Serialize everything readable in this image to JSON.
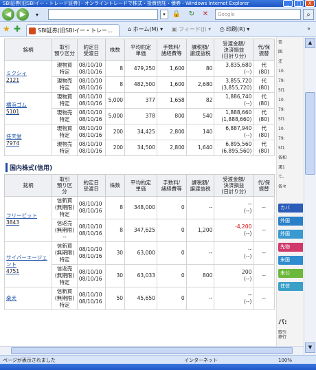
{
  "window": {
    "title": "SBI証券[旧SBIイー・トレード証券] - オンライントレードで株式・投資信託・債券 - Windows Internet Explorer",
    "min": "_",
    "max": "□",
    "close": "X"
  },
  "toolbar": {
    "back_icon": "back-arrow-icon",
    "forward_icon": "forward-arrow-icon",
    "address_value": "",
    "search_placeholder": "Google",
    "search_icon": "magnifier-icon"
  },
  "favbar": {
    "tab_label": "SBI証券(旧SBIイー・トレー...",
    "home_label": "ホーム(M)",
    "feed_label": "フィード(J)",
    "print_label": "印刷(R)",
    "more": "»"
  },
  "genbutsu": {
    "headers": [
      "銘柄",
      "取引\n預り区分",
      "約定日\n受渡日",
      "株数",
      "平均約定\n単価",
      "手数料/\n諸経費等",
      "課税額/\n譲渡益税",
      "受渡金額/\n決済損益\n(日計り分)",
      "代/保\n振替"
    ],
    "stocks": [
      {
        "name": "ミクシィ",
        "code": "2121",
        "rows": [
          {
            "type": "現物買",
            "acct": "特定",
            "d1": "08/10/10",
            "d2": "08/10/16",
            "qty": "8",
            "price": "479,250",
            "fee": "1,600",
            "tax": "80",
            "amt": "3,835,680",
            "sub": "(--)",
            "neg": false,
            "daiho": "代",
            "daiho2": "(80)"
          },
          {
            "type": "現物売",
            "acct": "特定",
            "d1": "08/10/10",
            "d2": "08/10/16",
            "qty": "8",
            "price": "482,500",
            "fee": "1,600",
            "tax": "2,680",
            "amt": "3,855,720",
            "sub": "(3,855,720)",
            "neg": false,
            "daiho": "代",
            "daiho2": "(80)"
          }
        ]
      },
      {
        "name": "横浜ゴム",
        "code": "5101",
        "rows": [
          {
            "type": "現物買",
            "acct": "特定",
            "d1": "08/10/10",
            "d2": "08/10/16",
            "qty": "5,000",
            "price": "377",
            "fee": "1,658",
            "tax": "82",
            "amt": "1,886,740",
            "sub": "(--)",
            "neg": false,
            "daiho": "代",
            "daiho2": "(80)"
          },
          {
            "type": "現物売",
            "acct": "特定",
            "d1": "08/10/10",
            "d2": "08/10/16",
            "qty": "5,000",
            "price": "378",
            "fee": "800",
            "tax": "540",
            "amt": "1,888,660",
            "sub": "(1,888,660)",
            "neg": false,
            "daiho": "代",
            "daiho2": "(80)"
          }
        ]
      },
      {
        "name": "任天堂",
        "code": "7974",
        "rows": [
          {
            "type": "現物買",
            "acct": "特定",
            "d1": "08/10/10",
            "d2": "08/10/16",
            "qty": "200",
            "price": "34,425",
            "fee": "2,800",
            "tax": "140",
            "amt": "6,887,940",
            "sub": "(--)",
            "neg": false,
            "daiho": "代",
            "daiho2": "(80)"
          },
          {
            "type": "現物売",
            "acct": "特定",
            "d1": "08/10/10",
            "d2": "08/10/16",
            "qty": "200",
            "price": "34,500",
            "fee": "2,800",
            "tax": "1,640",
            "amt": "6,895,560",
            "sub": "(6,895,560)",
            "neg": false,
            "daiho": "代",
            "daiho2": "(80)"
          }
        ]
      }
    ]
  },
  "shinyo": {
    "section_title": "国内株式(信用)",
    "headers": [
      "銘柄",
      "取引\n預り区\n分",
      "約定日\n受渡日",
      "株数",
      "平均約定\n単価",
      "手数料/\n諸経費等",
      "課税額/\n譲渡益税",
      "受渡金額/\n決済損益\n(日計り分)",
      "代/保\n振替"
    ],
    "stocks": [
      {
        "name": "フリービット",
        "code": "3843",
        "rows": [
          {
            "type": "信新買\n(無期限)",
            "acct": "特定",
            "d1": "08/10/10",
            "d2": "08/10/16",
            "qty": "8",
            "price": "348,000",
            "fee": "0",
            "tax": "--",
            "amt": "--",
            "sub": "(--)",
            "neg": false,
            "daiho": "--",
            "daiho2": ""
          },
          {
            "type": "信返売\n(無期限)",
            "acct": "--",
            "d1": "08/10/10",
            "d2": "08/10/16",
            "qty": "8",
            "price": "347,625",
            "fee": "0",
            "tax": "1,200",
            "amt": "-4,200",
            "sub": "(--)",
            "neg": true,
            "daiho": "--",
            "daiho2": ""
          }
        ]
      },
      {
        "name": "サイバーエージェント",
        "code": "4751",
        "rows": [
          {
            "type": "信新買\n(無期限)",
            "acct": "特定",
            "d1": "08/10/10",
            "d2": "08/10/16",
            "qty": "30",
            "price": "63,000",
            "fee": "0",
            "tax": "--",
            "amt": "--",
            "sub": "(--)",
            "neg": false,
            "daiho": "--",
            "daiho2": ""
          },
          {
            "type": "信返売\n(無期限)",
            "acct": "特定",
            "d1": "08/10/10",
            "d2": "08/10/16",
            "qty": "30",
            "price": "63,033",
            "fee": "0",
            "tax": "800",
            "amt": "200",
            "sub": "(--)",
            "neg": false,
            "daiho": "--",
            "daiho2": ""
          }
        ]
      },
      {
        "name": "楽天",
        "code": "",
        "rows": [
          {
            "type": "信新買\n(無期限)",
            "acct": "特定",
            "d1": "08/10/10",
            "d2": "08/10/16",
            "qty": "50",
            "price": "45,650",
            "fee": "0",
            "tax": "--",
            "amt": "--",
            "sub": "(--)",
            "neg": false,
            "daiho": "--",
            "daiho2": ""
          }
        ]
      }
    ]
  },
  "sidepanel": {
    "items": [
      "信",
      "国",
      "注",
      "10.",
      "79:",
      "5f1",
      "10.",
      "79:",
      "5f1",
      "10.",
      "79:",
      "5f1",
      "各和",
      "漢1",
      "て、",
      "各々"
    ],
    "buttons": [
      {
        "label": "カバ",
        "color": "#2a5cb8"
      },
      {
        "label": "外国",
        "color": "#2a7fc8"
      },
      {
        "label": "外国",
        "color": "#3a9ad0"
      },
      {
        "label": "先物",
        "color": "#d03a6a"
      },
      {
        "label": "米国",
        "color": "#2e8ccf"
      },
      {
        "label": "未公",
        "color": "#6cb83a"
      },
      {
        "label": "住信",
        "color": "#3aa0c8"
      }
    ],
    "bottom_label": "パ:",
    "bottom_sub": "取引\n移行"
  },
  "status": {
    "text": "ページが表示されました",
    "zone": "インターネット",
    "zoom": "100%"
  }
}
